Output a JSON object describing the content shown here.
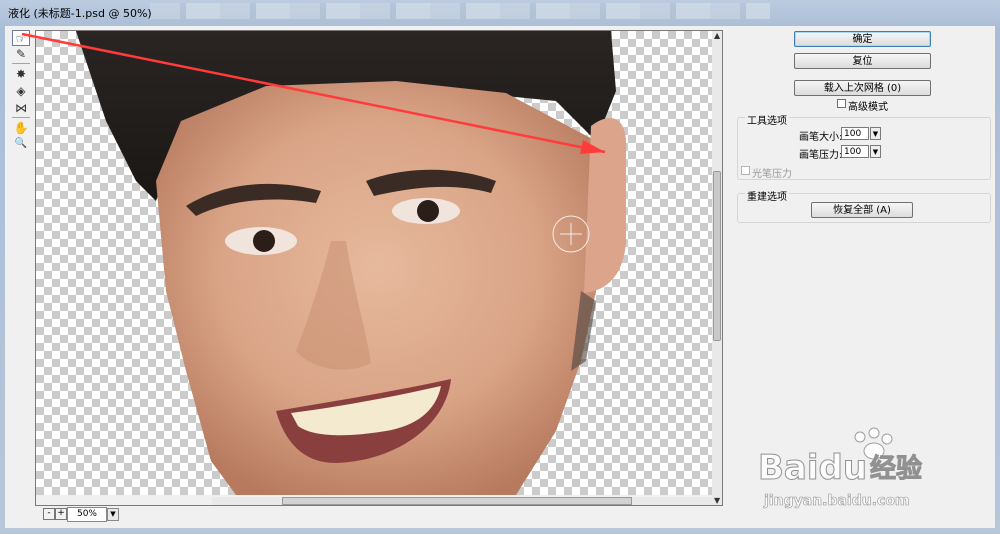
{
  "window": {
    "title": "液化 (未标题-1.psd @ 50%)"
  },
  "tools": [
    {
      "name": "forward-warp-tool",
      "glyph": "☞",
      "active": true
    },
    {
      "name": "reconstruct-tool",
      "glyph": "✎"
    },
    {
      "name": "pucker-tool",
      "glyph": "✸"
    },
    {
      "name": "bloat-tool",
      "glyph": "◈"
    },
    {
      "name": "push-left-tool",
      "glyph": "⋈"
    },
    {
      "name": "hand-tool",
      "glyph": "✋"
    },
    {
      "name": "zoom-tool",
      "glyph": "🔍"
    }
  ],
  "canvas": {
    "zoom_value": "50%",
    "zoom_minus": "-",
    "zoom_plus": "+"
  },
  "panel": {
    "ok_label": "确定",
    "reset_label": "复位",
    "load_mesh_label": "载入上次网格 (0)",
    "advanced_mode_label": "高级模式",
    "tool_options_title": "工具选项",
    "brush_size_label": "画笔大小:",
    "brush_size_value": "100",
    "brush_pressure_label": "画笔压力:",
    "brush_pressure_value": "100",
    "stylus_pressure_label": "光笔压力",
    "reconstruct_title": "重建选项",
    "restore_all_label": "恢复全部 (A)"
  },
  "watermark": {
    "brand": "Baidu",
    "cn": "经验",
    "url": "jingyan.baidu.com"
  },
  "colors": {
    "annotation_arrow": "#ff3b3b",
    "default_button_border": "#3c7fb1"
  }
}
